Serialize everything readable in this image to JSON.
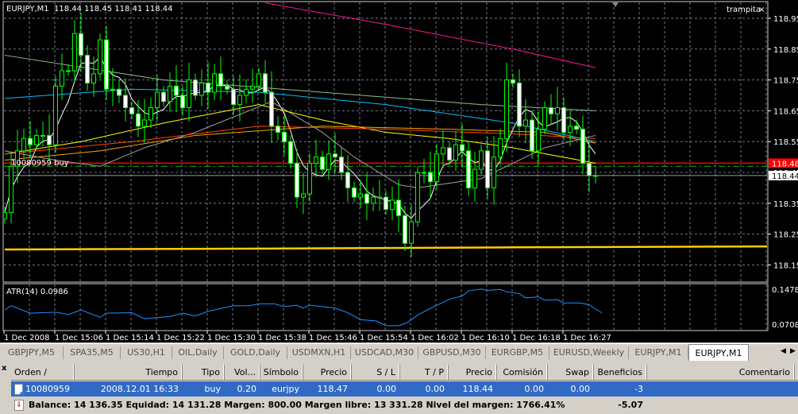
{
  "chart": {
    "header": "EURJPY,M1  118.44 118.45 118.41 118.44",
    "ea_label": "trampita",
    "close_glyph": "×",
    "order_label": "10080959 buy",
    "price_ticks": [
      "118.95",
      "118.85",
      "118.75",
      "118.65",
      "118.55",
      "118.45",
      "118.35",
      "118.25",
      "118.15"
    ],
    "price_tick_values": [
      118.95,
      118.85,
      118.75,
      118.65,
      118.55,
      118.45,
      118.35,
      118.25,
      118.15
    ],
    "ask_line": {
      "value": 118.48,
      "label": "118.48",
      "color": "#ff0000"
    },
    "bid_line": {
      "value": 118.44,
      "label": "118.44"
    },
    "order_line": {
      "value": 118.47,
      "color": "#00c000"
    },
    "time_labels": [
      "1 Dec 2008",
      "1 Dec 15:06",
      "1 Dec 15:14",
      "1 Dec 15:22",
      "1 Dec 15:30",
      "1 Dec 15:38",
      "1 Dec 15:46",
      "1 Dec 15:54",
      "1 Dec 16:02",
      "1 Dec 16:10",
      "1 Dec 16:18",
      "1 Dec 16:27"
    ],
    "candle_colors": {
      "outline": "#00ff00",
      "bull_fill": "#000000",
      "bear_fill": "#ffffff"
    },
    "closes": [
      118.32,
      118.47,
      118.52,
      118.56,
      118.54,
      118.57,
      118.57,
      118.54,
      118.73,
      118.78,
      118.78,
      118.9,
      118.83,
      118.74,
      118.77,
      118.88,
      118.72,
      118.72,
      118.7,
      118.66,
      118.64,
      118.6,
      118.62,
      118.66,
      118.71,
      118.68,
      118.73,
      118.7,
      118.66,
      118.75,
      118.7,
      118.74,
      118.71,
      118.77,
      118.73,
      118.72,
      118.67,
      118.7,
      118.72,
      118.73,
      118.77,
      118.71,
      118.6,
      118.58,
      118.55,
      118.48,
      118.37,
      118.38,
      118.48,
      118.5,
      118.46,
      118.51,
      118.5,
      118.45,
      118.4,
      118.37,
      118.38,
      118.35,
      118.37,
      118.37,
      118.33,
      118.36,
      118.31,
      118.22,
      118.29,
      118.45,
      118.45,
      118.42,
      118.51,
      118.53,
      118.49,
      118.54,
      118.52,
      118.4,
      118.46,
      118.52,
      118.4,
      118.5,
      118.56,
      118.75,
      118.74,
      118.6,
      118.62,
      118.52,
      118.59,
      118.66,
      118.64,
      118.66,
      118.58,
      118.6,
      118.59,
      118.48,
      118.44,
      118.44
    ],
    "first_open": 118.3,
    "moving_averages": [
      {
        "color": "#ffffff",
        "type": "fast"
      },
      {
        "color": "#a0a0a0",
        "points": [
          [
            0,
            118.52
          ],
          [
            8,
            118.49
          ],
          [
            15,
            118.47
          ],
          [
            22,
            118.53
          ],
          [
            30,
            118.58
          ],
          [
            42,
            118.68
          ],
          [
            50,
            118.58
          ],
          [
            55,
            118.5
          ],
          [
            62,
            118.41
          ],
          [
            65,
            118.4
          ],
          [
            75,
            118.43
          ],
          [
            85,
            118.53
          ],
          [
            93,
            118.57
          ]
        ]
      },
      {
        "color": "#ffff00",
        "points": [
          [
            0,
            118.51
          ],
          [
            12,
            118.55
          ],
          [
            25,
            118.61
          ],
          [
            40,
            118.67
          ],
          [
            50,
            118.62
          ],
          [
            60,
            118.58
          ],
          [
            70,
            118.56
          ],
          [
            80,
            118.53
          ],
          [
            93,
            118.48
          ]
        ]
      },
      {
        "color": "#ffa500",
        "points": [
          [
            0,
            118.49
          ],
          [
            15,
            118.52
          ],
          [
            30,
            118.57
          ],
          [
            50,
            118.6
          ],
          [
            70,
            118.59
          ],
          [
            85,
            118.58
          ],
          [
            93,
            118.545
          ]
        ]
      },
      {
        "color": "#ff4500",
        "points": [
          [
            0,
            118.51
          ],
          [
            20,
            118.55
          ],
          [
            40,
            118.6
          ],
          [
            60,
            118.59
          ],
          [
            80,
            118.575
          ],
          [
            93,
            118.56
          ]
        ]
      },
      {
        "color": "#00bfff",
        "points": [
          [
            0,
            118.69
          ],
          [
            20,
            118.72
          ],
          [
            40,
            118.71
          ],
          [
            60,
            118.67
          ],
          [
            80,
            118.61
          ],
          [
            93,
            118.55
          ]
        ]
      },
      {
        "color": "#8fbc8f",
        "points": [
          [
            0,
            118.83
          ],
          [
            25,
            118.75
          ],
          [
            50,
            118.71
          ],
          [
            75,
            118.67
          ],
          [
            93,
            118.65
          ]
        ]
      },
      {
        "color": "#ff1493",
        "points": [
          [
            41,
            119.0
          ],
          [
            60,
            118.93
          ],
          [
            80,
            118.85
          ],
          [
            93,
            118.79
          ]
        ]
      },
      {
        "color": "#ffcc00",
        "thick": true,
        "points": [
          [
            0,
            118.2
          ],
          [
            40,
            118.203
          ],
          [
            80,
            118.207
          ],
          [
            120,
            118.21
          ]
        ]
      }
    ]
  },
  "atr": {
    "label": "ATR(14) 0.0986",
    "max_label": "0.1478",
    "min_label": "0.0708",
    "range": [
      0.0708,
      0.1478
    ],
    "color": "#1e90ff",
    "points": [
      [
        0,
        0.105
      ],
      [
        1,
        0.114
      ],
      [
        4,
        0.098
      ],
      [
        8,
        0.1
      ],
      [
        10,
        0.095
      ],
      [
        12,
        0.105
      ],
      [
        15,
        0.089
      ],
      [
        16,
        0.098
      ],
      [
        20,
        0.099
      ],
      [
        22,
        0.086
      ],
      [
        26,
        0.091
      ],
      [
        28,
        0.098
      ],
      [
        30,
        0.092
      ],
      [
        32,
        0.102
      ],
      [
        36,
        0.114
      ],
      [
        38.5,
        0.114
      ],
      [
        40,
        0.118
      ],
      [
        42.5,
        0.118
      ],
      [
        44,
        0.112
      ],
      [
        46,
        0.115
      ],
      [
        47,
        0.109
      ],
      [
        48,
        0.115
      ],
      [
        52,
        0.109
      ],
      [
        54,
        0.099
      ],
      [
        56,
        0.084
      ],
      [
        58.5,
        0.081
      ],
      [
        60,
        0.071
      ],
      [
        62,
        0.071
      ],
      [
        63.4,
        0.078
      ],
      [
        65,
        0.094
      ],
      [
        67.4,
        0.111
      ],
      [
        70,
        0.128
      ],
      [
        72,
        0.135
      ],
      [
        73,
        0.146
      ],
      [
        75,
        0.15
      ],
      [
        76,
        0.147
      ],
      [
        78,
        0.149
      ],
      [
        79,
        0.144
      ],
      [
        81,
        0.14
      ],
      [
        82,
        0.131
      ],
      [
        84,
        0.133
      ],
      [
        85,
        0.126
      ],
      [
        87,
        0.127
      ],
      [
        88,
        0.12
      ],
      [
        90.6,
        0.12
      ],
      [
        92,
        0.116
      ],
      [
        94,
        0.0986
      ]
    ]
  },
  "tabs": [
    {
      "label": "GBPJPY,M5",
      "active": false
    },
    {
      "label": "SPA35,M5",
      "active": false
    },
    {
      "label": "US30,H1",
      "active": false
    },
    {
      "label": "OIL,Daily",
      "active": false
    },
    {
      "label": "GOLD,Daily",
      "active": false
    },
    {
      "label": "USDMXN,H1",
      "active": false
    },
    {
      "label": "USDCAD,M30",
      "active": false
    },
    {
      "label": "GBPUSD,M30",
      "active": false
    },
    {
      "label": "EURGBP,M5",
      "active": false
    },
    {
      "label": "EURUSD,Weekly",
      "active": false
    },
    {
      "label": "EURJPY,M1",
      "active": false
    },
    {
      "label": "EURJPY,M1",
      "active": true
    }
  ],
  "tab_scroll": {
    "left": "◀",
    "right": "▶"
  },
  "terminal": {
    "close_label": "x",
    "columns": [
      "Orden  /",
      "Tiempo",
      "Tipo",
      "Vol...",
      "Símbolo",
      "Precio",
      "S / L",
      "T / P",
      "Precio",
      "Comisión",
      "Swap",
      "Beneficios",
      "Comentario"
    ],
    "order": [
      "10080959",
      "2008.12.01 16:33",
      "buy",
      "0.20",
      "eurjpy",
      "118.47",
      "0.00",
      "0.00",
      "118.44",
      "0.00",
      "0.00",
      "-3",
      ""
    ],
    "summary": "Balance: 14 136.35  Equidad: 14 131.28  Margen: 800.00  Margen libre: 13 331.28  Nivel del margen: 1766.41%",
    "total_profit": "-5.07"
  }
}
